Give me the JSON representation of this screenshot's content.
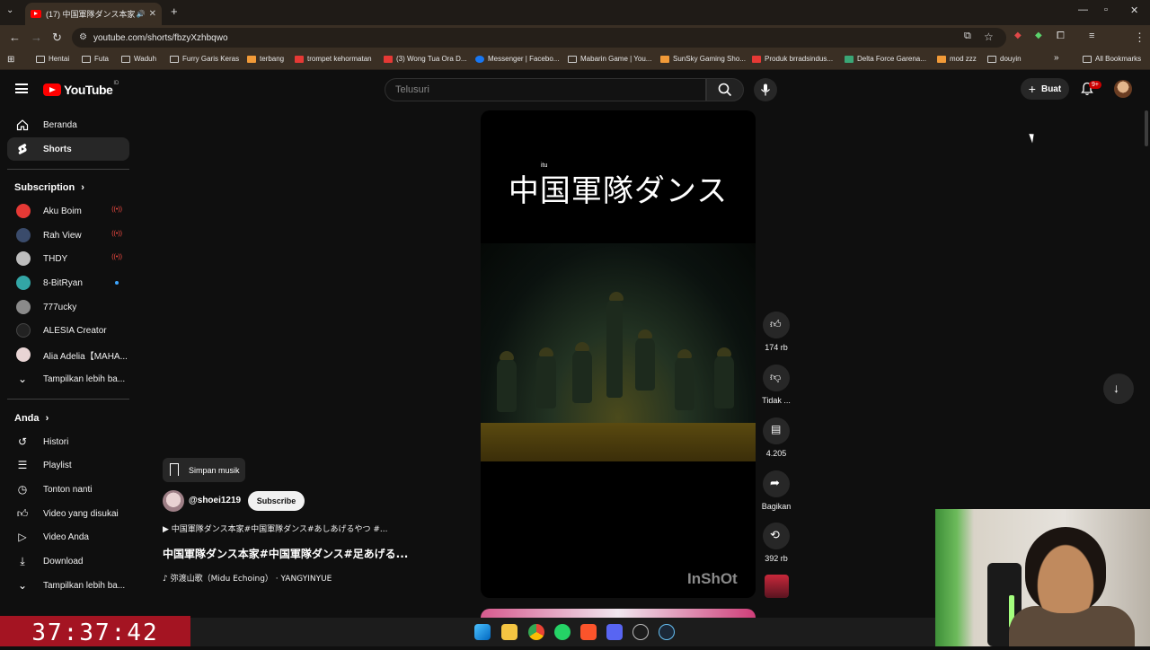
{
  "browser": {
    "tab_title": "(17) 中国軍隊ダンス本家#中国",
    "url": "youtube.com/shorts/fbzyXzhbqwo",
    "bookmarks": [
      "Hentai",
      "Futa",
      "Waduh",
      "Furry Garis Keras",
      "terbang",
      "trompet kehormatan",
      "(3) Wong Tua Ora D...",
      "Messenger | Facebo...",
      "Mabarin Game | You...",
      "SunSky Gaming Sho...",
      "Produk brradsindus...",
      "Delta Force Garena...",
      "mod zzz",
      "douyin"
    ],
    "all_bookmarks": "All Bookmarks"
  },
  "header": {
    "logo_text": "YouTube",
    "country_code": "ID",
    "search_placeholder": "Telusuri",
    "create_label": "Buat",
    "notif_badge": "9+"
  },
  "sidebar": {
    "main": [
      {
        "label": "Beranda",
        "icon": "home-icon"
      },
      {
        "label": "Shorts",
        "icon": "shorts-icon",
        "active": true
      }
    ],
    "subscription_header": "Subscription",
    "subscriptions": [
      {
        "label": "Aku Boim",
        "status": "live",
        "color": "#e53935"
      },
      {
        "label": "Rah View",
        "status": "live",
        "color": "#3a4b6b"
      },
      {
        "label": "THDY",
        "status": "live",
        "color": "#bdbdbd"
      },
      {
        "label": "8-BitRyan",
        "status": "new",
        "color": "#33a6a6"
      },
      {
        "label": "777ucky",
        "status": "",
        "color": "#8a8a8a"
      },
      {
        "label": "ALESIA Creator",
        "status": "",
        "color": "#222222"
      },
      {
        "label": "Alia Adelia【MAHA...",
        "status": "",
        "color": "#e9d5d5"
      }
    ],
    "show_more_subs": "Tampilkan lebih ba...",
    "you_header": "Anda",
    "you_items": [
      {
        "label": "Histori",
        "icon": "history-icon"
      },
      {
        "label": "Playlist",
        "icon": "playlist-icon"
      },
      {
        "label": "Tonton nanti",
        "icon": "clock-icon"
      },
      {
        "label": "Video yang disukai",
        "icon": "thumb-up-icon"
      },
      {
        "label": "Video Anda",
        "icon": "video-icon"
      },
      {
        "label": "Download",
        "icon": "download-icon"
      }
    ],
    "show_more_you": "Tampilkan lebih ba..."
  },
  "video": {
    "overlay_title": "中国軍隊ダンス",
    "overlay_small": "itu",
    "watermark": "InShOt"
  },
  "actions": {
    "likes": "174 rb",
    "dislike": "Tidak ...",
    "comments": "4.205",
    "share": "Bagikan",
    "remix": "392 rb"
  },
  "meta": {
    "save_music": "Simpan musik",
    "channel": "@shoei1219",
    "subscribe": "Subscribe",
    "description": "▶ 中国軍隊ダンス本家#中国軍隊ダンス#あしあげるやつ #...",
    "title": "中国軍隊ダンス本家#中国軍隊ダンス#足あげる...",
    "music": "♪ 弥渡山歌（Midu Echoing） · YANGYINYUE"
  },
  "overlay": {
    "timer": "37:37:42"
  }
}
